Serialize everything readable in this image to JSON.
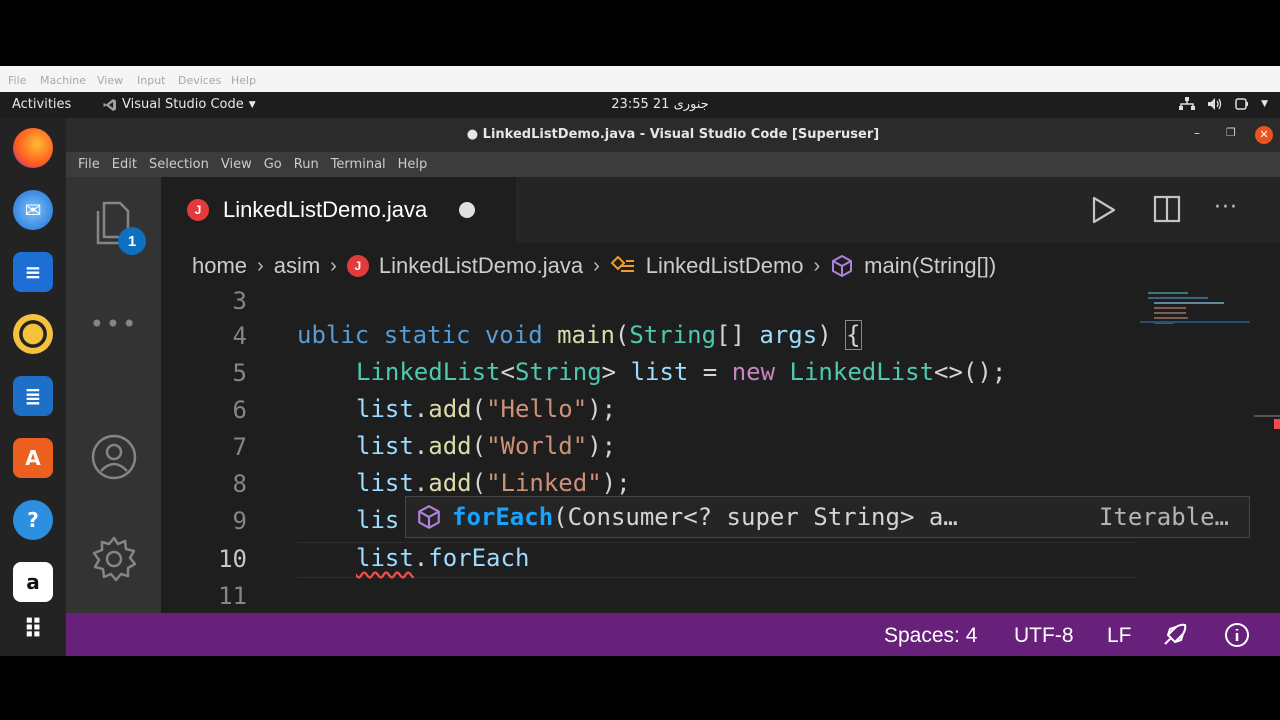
{
  "vbox_menu": [
    "File",
    "Machine",
    "View",
    "Input",
    "Devices",
    "Help"
  ],
  "topbar": {
    "activities": "Activities",
    "app_name": "Visual Studio Code",
    "clock": "23:55 21 جنوری"
  },
  "window": {
    "title": "● LinkedListDemo.java - Visual Studio Code [Superuser]"
  },
  "menu": [
    "File",
    "Edit",
    "Selection",
    "View",
    "Go",
    "Run",
    "Terminal",
    "Help"
  ],
  "activity_bar": {
    "explorer_badge": "1"
  },
  "tab": {
    "label": "LinkedListDemo.java",
    "file_icon": "J"
  },
  "breadcrumb": [
    "home",
    "asim",
    "LinkedListDemo.java",
    "LinkedListDemo",
    "main(String[])"
  ],
  "line_numbers": [
    "3",
    "4",
    "5",
    "6",
    "7",
    "8",
    "9",
    "10",
    "11"
  ],
  "code": {
    "l4_kw": "ublic static void",
    "l4_main": "main",
    "l4_type": "String",
    "l4_args": "args",
    "l5_type": "LinkedList",
    "l5_generic": "String",
    "l5_var": "list",
    "l5_new": "new",
    "l5_ctor": "LinkedList",
    "l6_var": "list",
    "l6_fn": "add",
    "l6_str": "\"Hello\"",
    "l7_var": "list",
    "l7_fn": "add",
    "l7_str": "\"World\"",
    "l8_var": "list",
    "l8_fn": "add",
    "l8_str": "\"Linked\"",
    "l9_var": "lis",
    "l10_var": "list",
    "l10_fn": "forEach"
  },
  "suggest": {
    "match": "forEach",
    "signature": "(Consumer<? super String> a…",
    "detail": "Iterable…"
  },
  "status": {
    "spaces": "Spaces: 4",
    "encoding": "UTF-8",
    "eol": "LF"
  },
  "colors": {
    "status_bar": "#68217a",
    "editor_bg": "#1e1e1e",
    "java_icon": "#e23b3b",
    "match": "#18a3ff"
  }
}
